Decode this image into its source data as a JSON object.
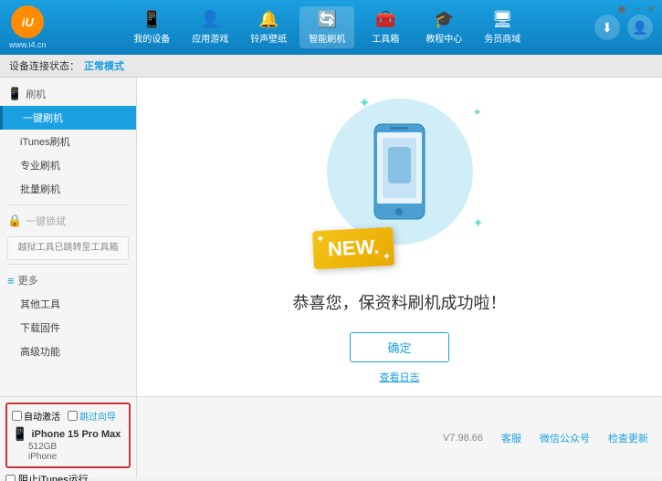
{
  "app": {
    "logo_text": "iU",
    "logo_subtext": "www.i4.cn",
    "win_controls": [
      "▣",
      "─",
      "✕"
    ]
  },
  "header": {
    "nav_items": [
      {
        "id": "my-device",
        "icon": "📱",
        "label": "我的设备"
      },
      {
        "id": "apps-games",
        "icon": "👤",
        "label": "应用游戏"
      },
      {
        "id": "ringtone",
        "icon": "🔔",
        "label": "铃声壁纸"
      },
      {
        "id": "smart-flash",
        "icon": "🔄",
        "label": "智能刷机",
        "active": true
      },
      {
        "id": "toolbox",
        "icon": "🧰",
        "label": "工具箱"
      },
      {
        "id": "tutorial",
        "icon": "🎓",
        "label": "教程中心"
      },
      {
        "id": "service",
        "icon": "🖥",
        "label": "务员商域"
      }
    ],
    "right_buttons": [
      "⬇",
      "👤"
    ]
  },
  "status_bar": {
    "label": "设备连接状态：",
    "value": "正常模式"
  },
  "sidebar": {
    "sections": [
      {
        "id": "flash",
        "icon": "📱",
        "title": "刷机",
        "items": [
          {
            "id": "one-key-flash",
            "label": "一键刷机",
            "active": true
          },
          {
            "id": "itunes-flash",
            "label": "iTunes刷机"
          },
          {
            "id": "pro-flash",
            "label": "专业刷机"
          },
          {
            "id": "batch-flash",
            "label": "批量刷机"
          }
        ]
      },
      {
        "id": "one-key-restore",
        "icon": "🔒",
        "title": "一键锁斌",
        "disabled": true,
        "notice": "越狱工具已跳转至工具箱"
      },
      {
        "id": "more",
        "icon": "≡",
        "title": "更多",
        "items": [
          {
            "id": "other-tools",
            "label": "其他工具"
          },
          {
            "id": "download-firmware",
            "label": "下载固件"
          },
          {
            "id": "advanced",
            "label": "高级功能"
          }
        ]
      }
    ]
  },
  "content": {
    "new_badge": "NEW.",
    "success_text": "恭喜您，保资料刷机成功啦！",
    "confirm_button": "确定",
    "log_link": "查看日志"
  },
  "bottom": {
    "checkboxes": [
      {
        "id": "auto-activate",
        "label": "自动激活"
      },
      {
        "id": "guided-export",
        "label": "跳过向导"
      }
    ],
    "device": {
      "icon": "📱",
      "name": "iPhone 15 Pro Max",
      "storage": "512GB",
      "type": "iPhone"
    },
    "itunes_label": "阻止iTunes运行",
    "version": "V7.98.66",
    "links": [
      "客服",
      "微信公众号",
      "检查更新"
    ]
  }
}
